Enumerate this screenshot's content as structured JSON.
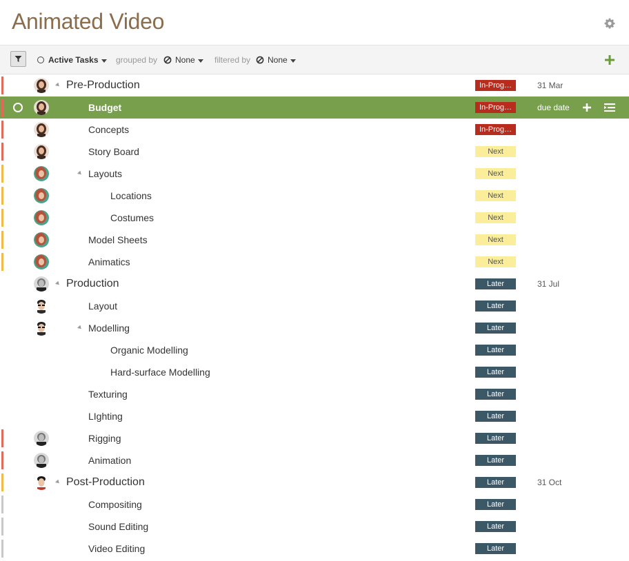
{
  "header": {
    "title": "Animated Video",
    "settings_icon": "gear-icon"
  },
  "toolbar": {
    "active_tasks_label": "Active Tasks",
    "grouped_by_label": "grouped by",
    "grouped_by_value": "None",
    "filtered_by_label": "filtered by",
    "filtered_by_value": "None"
  },
  "colors": {
    "selected_row": "#789f4c",
    "in_progress": "#b72c1d",
    "next": "#fbee9b",
    "later": "#3c5766",
    "edge_red": "#e06a5a",
    "edge_yellow": "#f0b94a",
    "edge_gray": "#c8c8c8",
    "title": "#8b6d4c"
  },
  "rows": [
    {
      "name": "Pre-Production",
      "level": 0,
      "group": true,
      "status": "In-Progress",
      "status_label": "In-Prog…",
      "due": "31 Mar",
      "avatar": "woman",
      "edge": "red"
    },
    {
      "name": "Budget",
      "level": 1,
      "group": false,
      "status": "In-Progress",
      "status_label": "In-Prog…",
      "due": "due date",
      "avatar": "woman",
      "edge": "red",
      "selected": true
    },
    {
      "name": "Concepts",
      "level": 1,
      "group": false,
      "status": "In-Progress",
      "status_label": "In-Prog…",
      "due": "",
      "avatar": "woman",
      "edge": "red"
    },
    {
      "name": "Story Board",
      "level": 1,
      "group": false,
      "status": "Next",
      "status_label": "Next",
      "due": "",
      "avatar": "woman",
      "edge": "red"
    },
    {
      "name": "Layouts",
      "level": 1,
      "group": true,
      "status": "Next",
      "status_label": "Next",
      "due": "",
      "avatar": "redhead",
      "edge": "yellow"
    },
    {
      "name": "Locations",
      "level": 2,
      "group": false,
      "status": "Next",
      "status_label": "Next",
      "due": "",
      "avatar": "redhead",
      "edge": "yellow"
    },
    {
      "name": "Costumes",
      "level": 2,
      "group": false,
      "status": "Next",
      "status_label": "Next",
      "due": "",
      "avatar": "redhead",
      "edge": "yellow"
    },
    {
      "name": "Model Sheets",
      "level": 1,
      "group": false,
      "status": "Next",
      "status_label": "Next",
      "due": "",
      "avatar": "redhead",
      "edge": "yellow"
    },
    {
      "name": "Animatics",
      "level": 1,
      "group": false,
      "status": "Next",
      "status_label": "Next",
      "due": "",
      "avatar": "redhead",
      "edge": "yellow"
    },
    {
      "name": "Production",
      "level": 0,
      "group": true,
      "status": "Later",
      "status_label": "Later",
      "due": "31 Jul",
      "avatar": "bw-man",
      "edge": ""
    },
    {
      "name": "Layout",
      "level": 1,
      "group": false,
      "status": "Later",
      "status_label": "Later",
      "due": "",
      "avatar": "glasses-man",
      "edge": ""
    },
    {
      "name": "Modelling",
      "level": 1,
      "group": true,
      "status": "Later",
      "status_label": "Later",
      "due": "",
      "avatar": "glasses-man",
      "edge": ""
    },
    {
      "name": "Organic Modelling",
      "level": 2,
      "group": false,
      "status": "Later",
      "status_label": "Later",
      "due": "",
      "avatar": "",
      "edge": ""
    },
    {
      "name": "Hard-surface Modelling",
      "level": 2,
      "group": false,
      "status": "Later",
      "status_label": "Later",
      "due": "",
      "avatar": "",
      "edge": ""
    },
    {
      "name": "Texturing",
      "level": 1,
      "group": false,
      "status": "Later",
      "status_label": "Later",
      "due": "",
      "avatar": "",
      "edge": ""
    },
    {
      "name": "LIghting",
      "level": 1,
      "group": false,
      "status": "Later",
      "status_label": "Later",
      "due": "",
      "avatar": "",
      "edge": ""
    },
    {
      "name": "Rigging",
      "level": 1,
      "group": false,
      "status": "Later",
      "status_label": "Later",
      "due": "",
      "avatar": "bw-man",
      "edge": "red"
    },
    {
      "name": "Animation",
      "level": 1,
      "group": false,
      "status": "Later",
      "status_label": "Later",
      "due": "",
      "avatar": "bw-man",
      "edge": "red"
    },
    {
      "name": "Post-Production",
      "level": 0,
      "group": true,
      "status": "Later",
      "status_label": "Later",
      "due": "31 Oct",
      "avatar": "man",
      "edge": "yellow"
    },
    {
      "name": "Compositing",
      "level": 1,
      "group": false,
      "status": "Later",
      "status_label": "Later",
      "due": "",
      "avatar": "",
      "edge": "gray"
    },
    {
      "name": "Sound Editing",
      "level": 1,
      "group": false,
      "status": "Later",
      "status_label": "Later",
      "due": "",
      "avatar": "",
      "edge": "gray"
    },
    {
      "name": "Video Editing",
      "level": 1,
      "group": false,
      "status": "Later",
      "status_label": "Later",
      "due": "",
      "avatar": "",
      "edge": "gray"
    }
  ]
}
